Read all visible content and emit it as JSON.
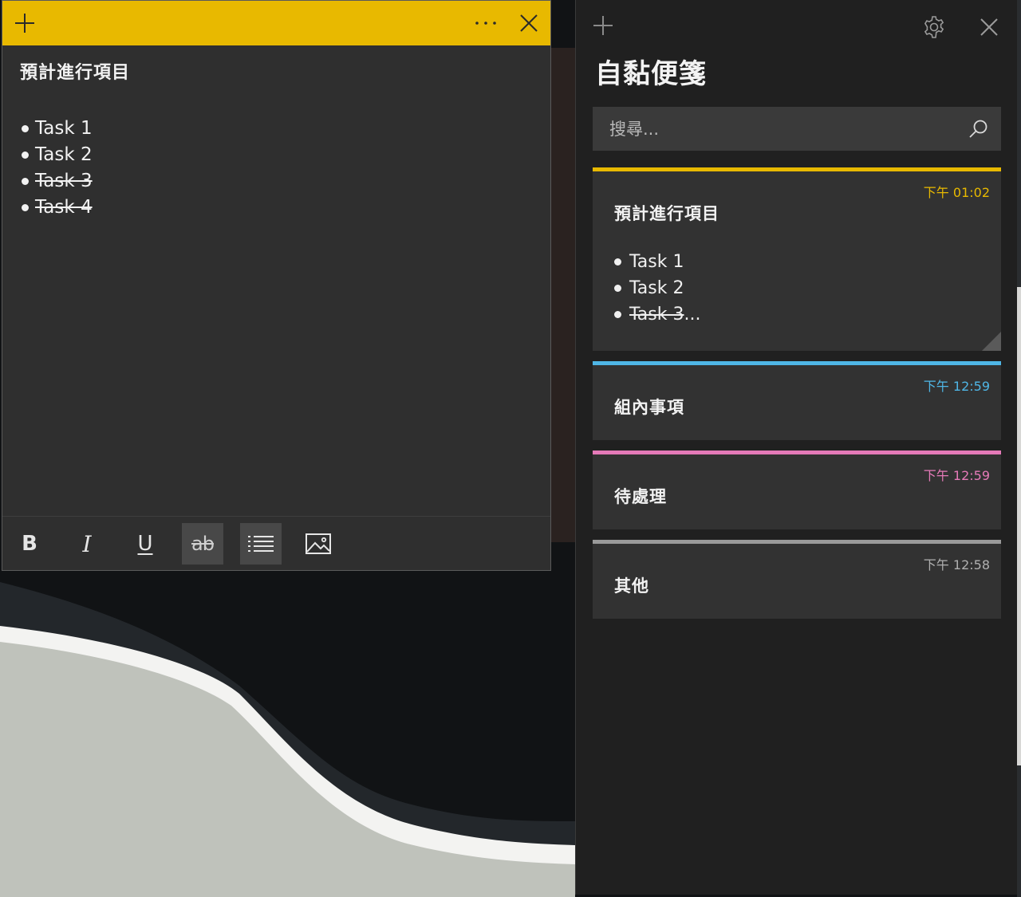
{
  "note_window": {
    "accent": "#e8b900",
    "titlebar": {
      "new_icon": "plus-icon",
      "menu_icon": "more-ellipsis-icon",
      "close_icon": "close-icon"
    },
    "title": "預計進行項目",
    "items": [
      {
        "text": "Task 1",
        "done": false
      },
      {
        "text": "Task 2",
        "done": false
      },
      {
        "text": "Task 3",
        "done": true
      },
      {
        "text": "Task 4",
        "done": true
      }
    ],
    "toolbar": {
      "bold": "B",
      "italic": "I",
      "underline": "U",
      "strikethrough": "ab",
      "strikethrough_active": true,
      "bullets_active": true,
      "bullets_icon": "bullet-list-icon",
      "image_icon": "image-icon"
    }
  },
  "panel": {
    "title": "自黏便箋",
    "new_icon": "plus-icon",
    "settings_icon": "gear-icon",
    "close_icon": "close-icon",
    "search": {
      "placeholder": "搜尋...",
      "value": ""
    },
    "notes": [
      {
        "time": "下午 01:02",
        "color": "#e8b900",
        "title": "預計進行項目",
        "items": [
          {
            "text": "Task 1",
            "done": false
          },
          {
            "text": "Task 2",
            "done": false
          },
          {
            "text": "Task 3",
            "done": true,
            "suffix": "..."
          }
        ]
      },
      {
        "time": "下午 12:59",
        "color": "#4fb6e6",
        "title": "組內事項"
      },
      {
        "time": "下午 12:59",
        "color": "#e57ab8",
        "title": "待處理"
      },
      {
        "time": "下午 12:58",
        "color": "#9a9a9a",
        "title": "其他"
      }
    ]
  }
}
